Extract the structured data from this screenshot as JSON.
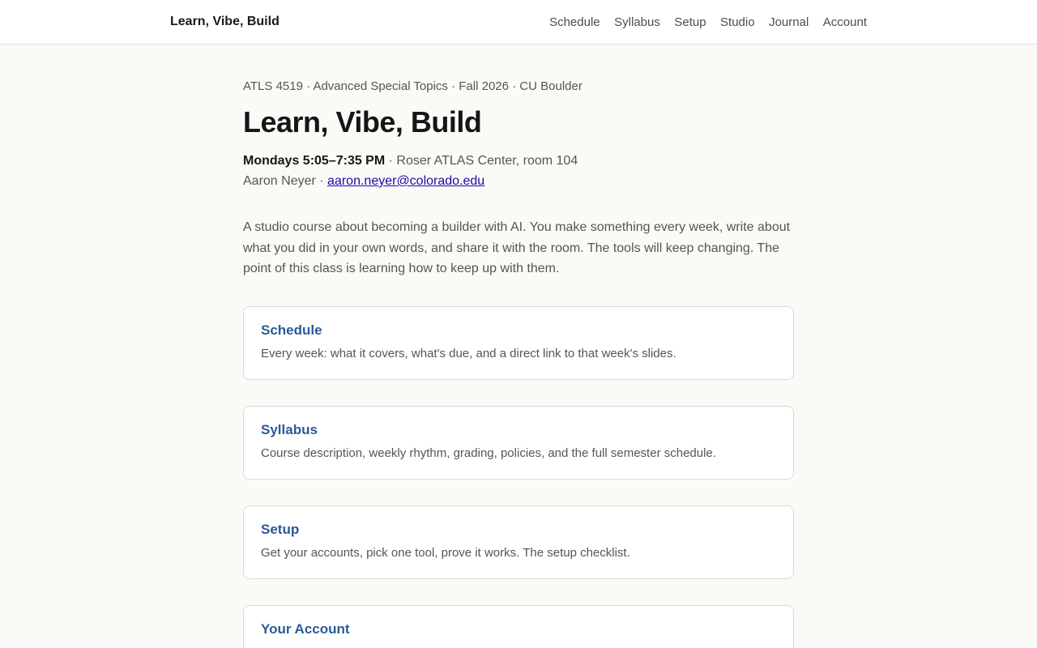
{
  "header": {
    "brand": "Learn, Vibe, Build",
    "nav": [
      "Schedule",
      "Syllabus",
      "Setup",
      "Studio",
      "Journal",
      "Account"
    ]
  },
  "main": {
    "eyebrow": "ATLS 4519 · Advanced Special Topics · Fall 2026 · CU Boulder",
    "title": "Learn, Vibe, Build",
    "time": "Mondays 5:05–7:35 PM",
    "location": " · Roser ATLAS Center, room 104",
    "instructor": "Aaron Neyer · ",
    "email": "aaron.neyer@colorado.edu",
    "intro": "A studio course about becoming a builder with AI. You make something every week, write about what you did in your own words, and share it with the room. The tools will keep changing. The point of this class is learning how to keep up with them.",
    "cards": [
      {
        "title": "Schedule",
        "desc": "Every week: what it covers, what's due, and a direct link to that week's slides."
      },
      {
        "title": "Syllabus",
        "desc": "Course description, weekly rhythm, grading, policies, and the full semester schedule."
      },
      {
        "title": "Setup",
        "desc": "Get your accounts, pick one tool, prove it works. The setup checklist."
      },
      {
        "title": "Your Account",
        "desc": ""
      }
    ]
  },
  "colors": {
    "background": "#fbfaf7",
    "card_title": "#2a5a96",
    "link": "#1a0dab"
  }
}
